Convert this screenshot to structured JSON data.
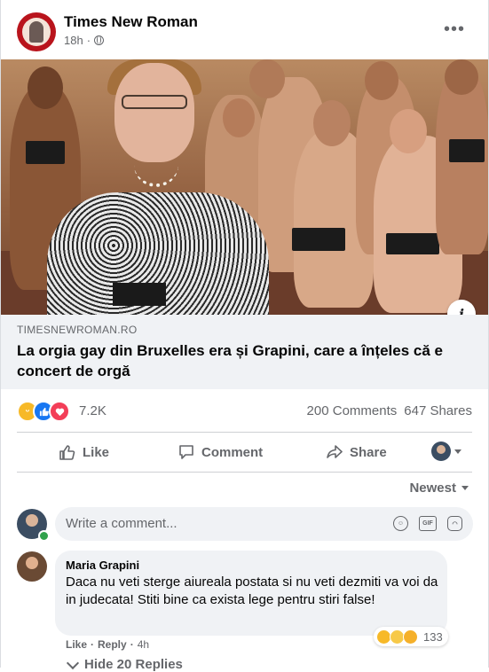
{
  "post": {
    "page_name": "Times New Roman",
    "time": "18h",
    "more_label": "•••",
    "link": {
      "domain": "TIMESNEWROMAN.RO",
      "headline": "La orgia gay din Bruxelles era și Grapini, care a înțeles că e concert de orgă",
      "info_label": "i"
    }
  },
  "stats": {
    "reactions_count": "7.2K",
    "comments": "200 Comments",
    "shares": "647 Shares",
    "reaction_icons": [
      "haha-icon",
      "like-icon",
      "love-icon"
    ]
  },
  "actions": {
    "like": "Like",
    "comment": "Comment",
    "share": "Share"
  },
  "comments_section": {
    "sort_label": "Newest",
    "write_placeholder": "Write a comment...",
    "comment": {
      "author": "Maria Grapini",
      "text": "Daca nu veti sterge aiureala postata si nu veti dezmiti va voi da in judecata! Stiti bine ca exista lege pentru stiri false!",
      "like_label": "Like",
      "reply_label": "Reply",
      "time": "4h",
      "reaction_count": "133"
    },
    "replies_label": "Hide 20 Replies"
  },
  "colors": {
    "accent": "#1877f2",
    "secondary_text": "#65676b",
    "link_bg": "#f0f2f5"
  }
}
